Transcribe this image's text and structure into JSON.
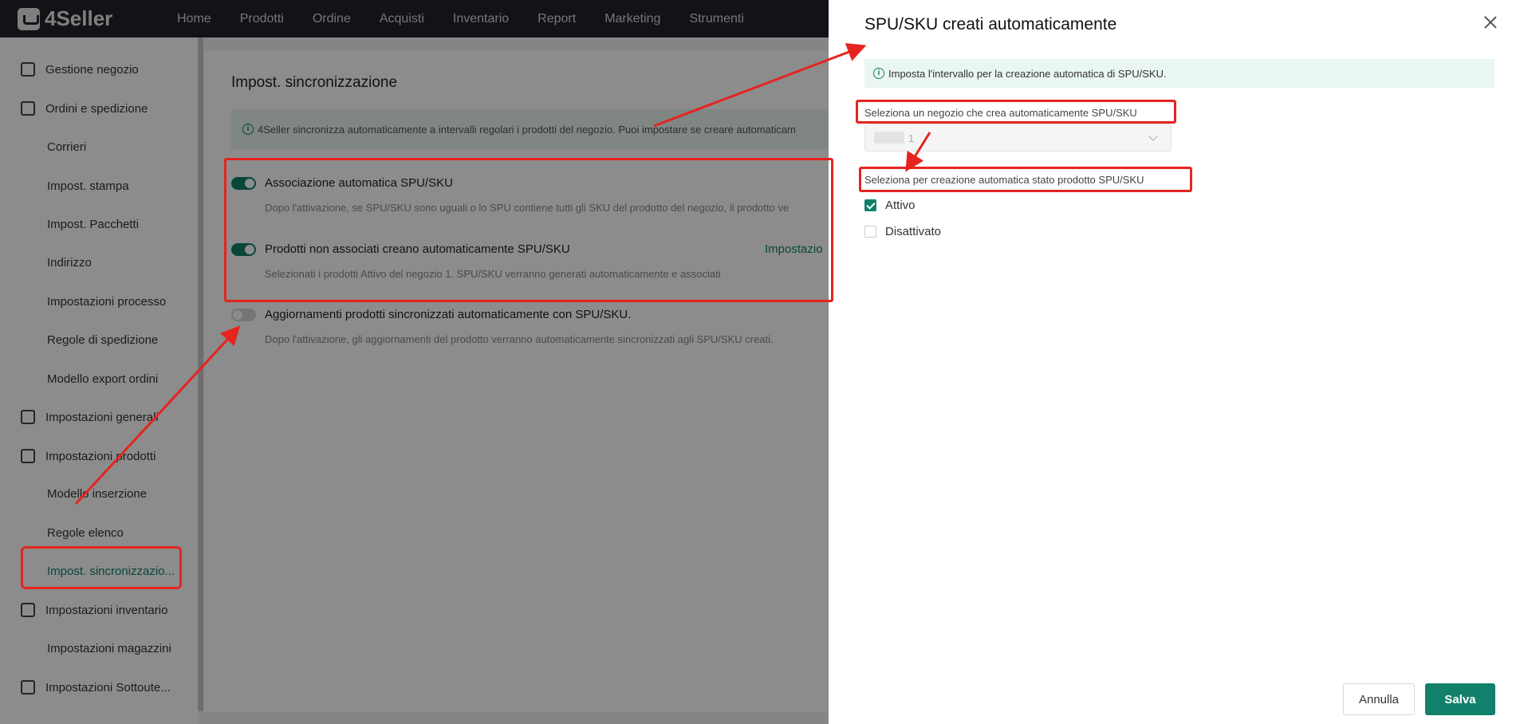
{
  "app": {
    "logo_text": "4Seller",
    "nav": [
      "Home",
      "Prodotti",
      "Ordine",
      "Acquisti",
      "Inventario",
      "Report",
      "Marketing",
      "Strumenti"
    ]
  },
  "sidebar": {
    "items": [
      {
        "label": "Gestione negozio",
        "type": "group",
        "icon": "store-icon"
      },
      {
        "label": "Ordini e spedizione",
        "type": "group",
        "icon": "clipboard-icon"
      },
      {
        "label": "Corrieri",
        "type": "sub"
      },
      {
        "label": "Impost. stampa",
        "type": "sub"
      },
      {
        "label": "Impost. Pacchetti",
        "type": "sub"
      },
      {
        "label": "Indirizzo",
        "type": "sub"
      },
      {
        "label": "Impostazioni processo",
        "type": "sub"
      },
      {
        "label": "Regole di spedizione",
        "type": "sub"
      },
      {
        "label": "Modello export ordini",
        "type": "sub"
      },
      {
        "label": "Impostazioni generali",
        "type": "group",
        "icon": "printer-icon"
      },
      {
        "label": "Impostazioni prodotti",
        "type": "group",
        "icon": "box-icon"
      },
      {
        "label": "Modello inserzione",
        "type": "sub"
      },
      {
        "label": "Regole elenco",
        "type": "sub"
      },
      {
        "label": "Impost. sincronizzazio...",
        "type": "sub",
        "active": true
      },
      {
        "label": "Impostazioni inventario",
        "type": "group",
        "icon": "inventory-icon"
      },
      {
        "label": "Impostazioni magazzini",
        "type": "sub"
      },
      {
        "label": "Impostazioni Sottoute...",
        "type": "group",
        "icon": "user-icon"
      }
    ]
  },
  "main": {
    "title": "Impost. sincronizzazione",
    "info": "4Seller sincronizza automaticamente a intervalli regolari i prodotti del negozio. Puoi impostare se creare automaticam",
    "options": [
      {
        "title": "Associazione automatica SPU/SKU",
        "desc": "Dopo l'attivazione, se SPU/SKU sono uguali o lo SPU contiene tutti gli SKU del prodotto del negozio, il prodotto ve",
        "enabled": true
      },
      {
        "title": "Prodotti non associati creano automaticamente SPU/SKU",
        "desc": "Selezionati i prodotti Attivo del negozio 1. SPU/SKU verranno generati automaticamente e associati",
        "enabled": true,
        "link": "Impostazio"
      },
      {
        "title": "Aggiornamenti prodotti sincronizzati automaticamente con SPU/SKU.",
        "desc": "Dopo l'attivazione, gli aggiornamenti del prodotto verranno automaticamente sincronizzati agli SPU/SKU creati.",
        "enabled": false
      }
    ]
  },
  "drawer": {
    "title": "SPU/SKU creati automaticamente",
    "info": "Imposta l'intervallo per la creazione automatica di SPU/SKU.",
    "store_label": "Seleziona un negozio che crea automaticamente SPU/SKU",
    "store_value": "1",
    "status_label": "Seleziona per creazione automatica stato prodotto SPU/SKU",
    "statuses": [
      {
        "label": "Attivo",
        "checked": true
      },
      {
        "label": "Disattivato",
        "checked": false
      }
    ],
    "cancel_label": "Annulla",
    "save_label": "Salva"
  },
  "colors": {
    "accent": "#12806a",
    "annotation": "#e52420",
    "topbar": "#1f2328"
  }
}
